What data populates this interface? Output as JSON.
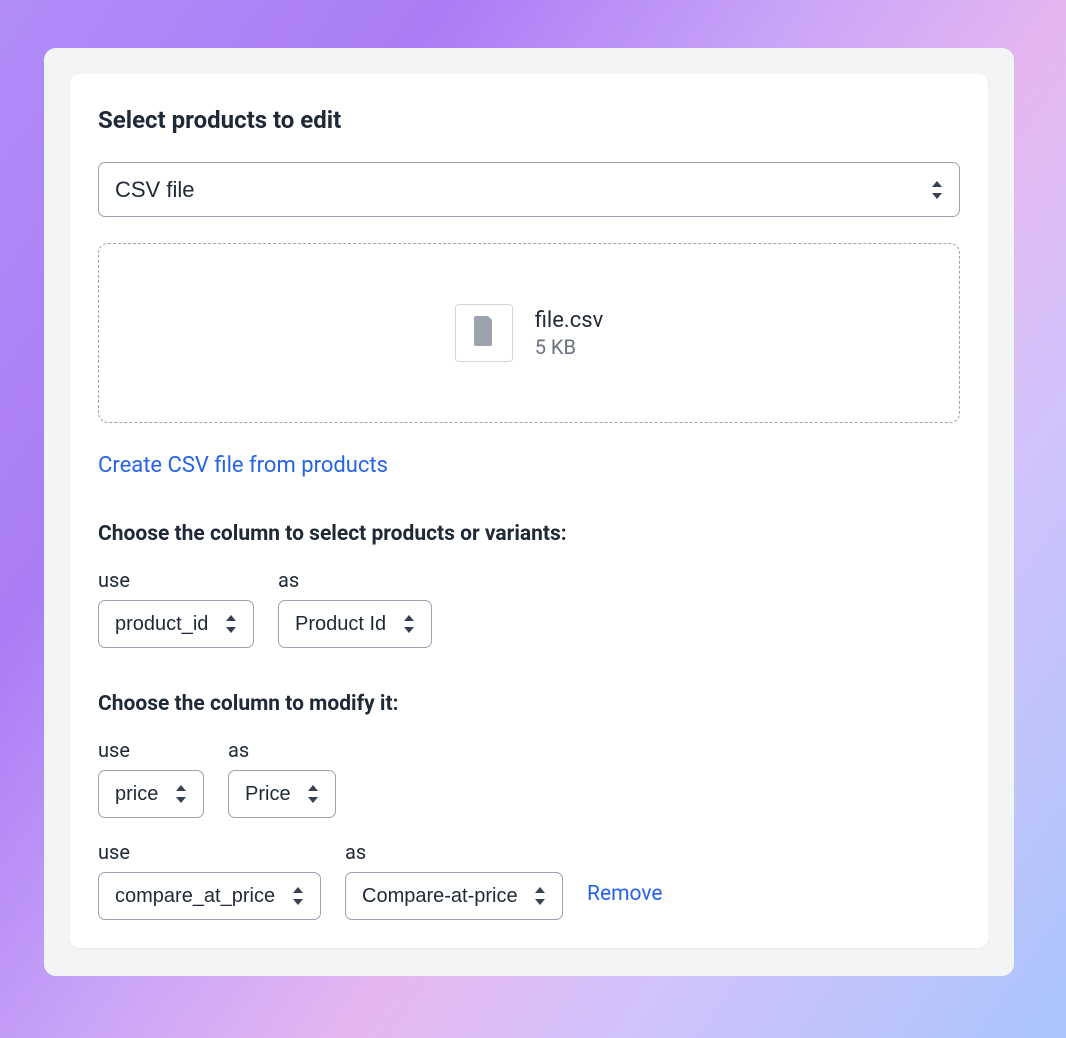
{
  "title": "Select products to edit",
  "source_select": {
    "value": "CSV file"
  },
  "file": {
    "name": "file.csv",
    "size": "5 KB"
  },
  "create_link": "Create CSV file from products",
  "section_select_column": "Choose the column to select products or variants:",
  "section_modify_column": "Choose the column to modify it:",
  "labels": {
    "use": "use",
    "as": "as",
    "remove": "Remove"
  },
  "selector_row": {
    "use_value": "product_id",
    "as_value": "Product Id"
  },
  "modify_rows": [
    {
      "use_value": "price",
      "as_value": "Price",
      "removable": false
    },
    {
      "use_value": "compare_at_price",
      "as_value": "Compare-at-price",
      "removable": true
    }
  ]
}
